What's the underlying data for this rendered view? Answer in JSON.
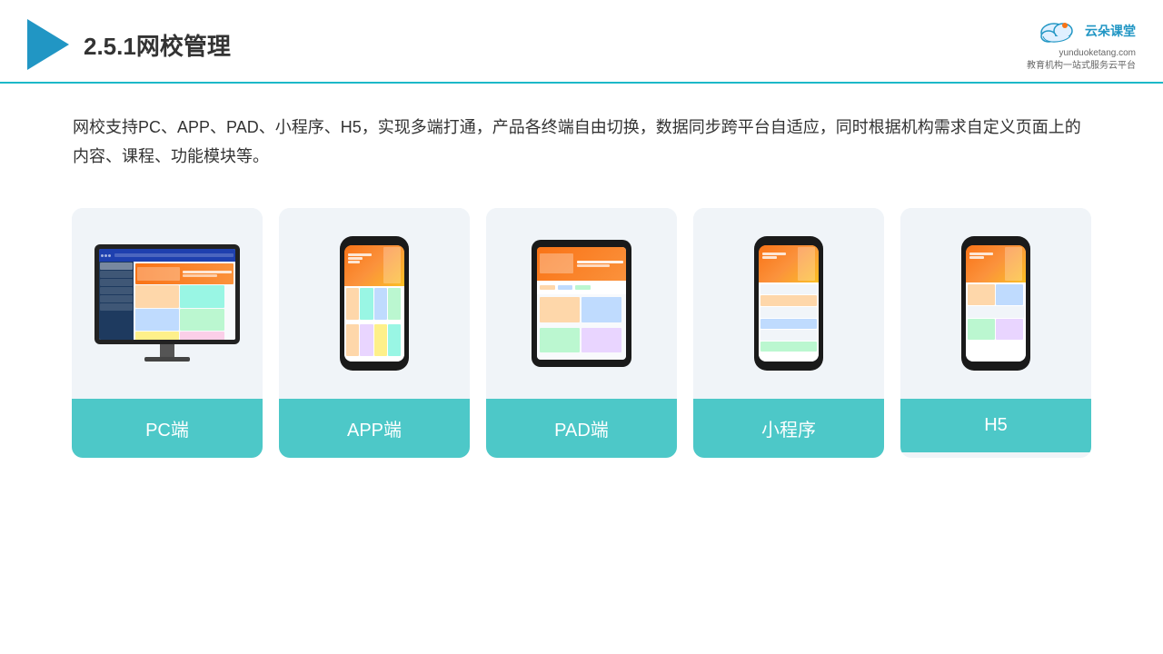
{
  "header": {
    "title": "2.5.1网校管理",
    "brand": {
      "name": "云朵课堂",
      "domain": "yunduoketang.com",
      "subtitle": "教育机构一站\n式服务云平台"
    }
  },
  "description": {
    "text": "网校支持PC、APP、PAD、小程序、H5，实现多端打通，产品各终端自由切换，数据同步跨平台自适应，同时根据机构需求自定义页面上的内容、课程、功能模块等。"
  },
  "cards": [
    {
      "id": "pc",
      "label": "PC端"
    },
    {
      "id": "app",
      "label": "APP端"
    },
    {
      "id": "pad",
      "label": "PAD端"
    },
    {
      "id": "miniprogram",
      "label": "小程序"
    },
    {
      "id": "h5",
      "label": "H5"
    }
  ],
  "colors": {
    "accent": "#4dc8c8",
    "header_border": "#1db8c8",
    "brand_blue": "#2196c4"
  }
}
